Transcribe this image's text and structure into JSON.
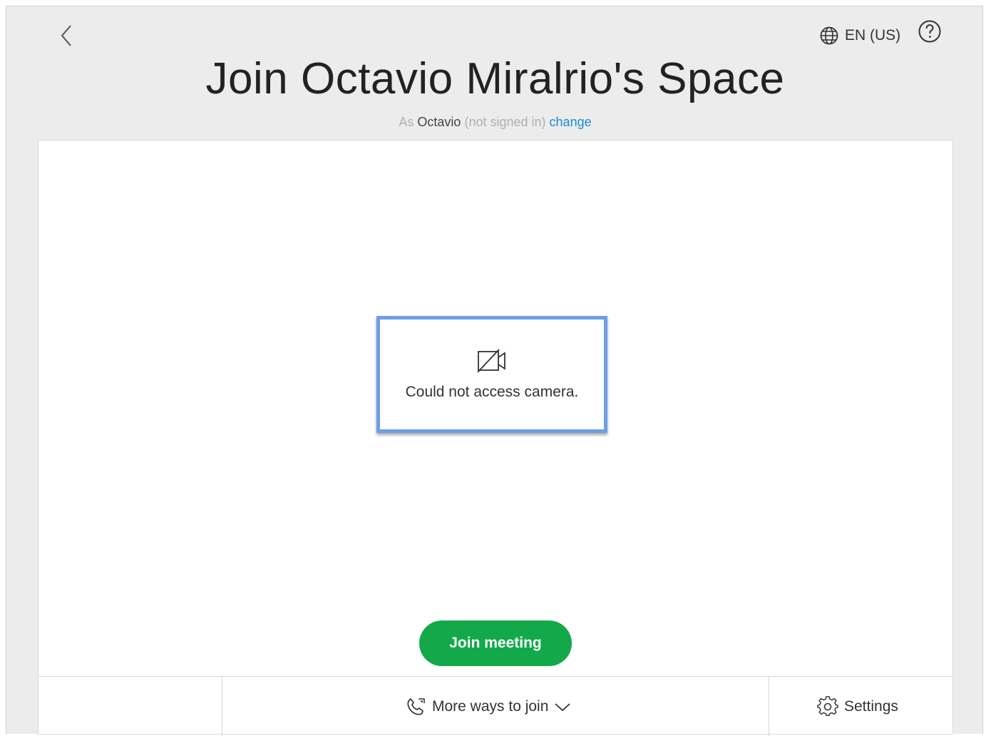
{
  "header": {
    "back_icon": "chevron-left-icon",
    "language_label": "EN (US)",
    "language_icon": "globe-icon",
    "help_icon": "help-circle-icon"
  },
  "title": "Join Octavio Miralrio's Space",
  "identity": {
    "prefix": "As",
    "name": "Octavio",
    "status": "(not signed in)",
    "change_link": "change"
  },
  "preview": {
    "camera_icon": "camera-off-icon",
    "message": "Could not access camera."
  },
  "join_button_label": "Join meeting",
  "footer": {
    "more_ways_label": "More ways to join",
    "more_ways_icon": "phone-icon",
    "settings_label": "Settings",
    "settings_icon": "gear-icon"
  },
  "colors": {
    "join_button": "#13a94a",
    "link": "#1b8ad8",
    "highlight_border": "#6e9ee6",
    "background": "#ececec"
  }
}
